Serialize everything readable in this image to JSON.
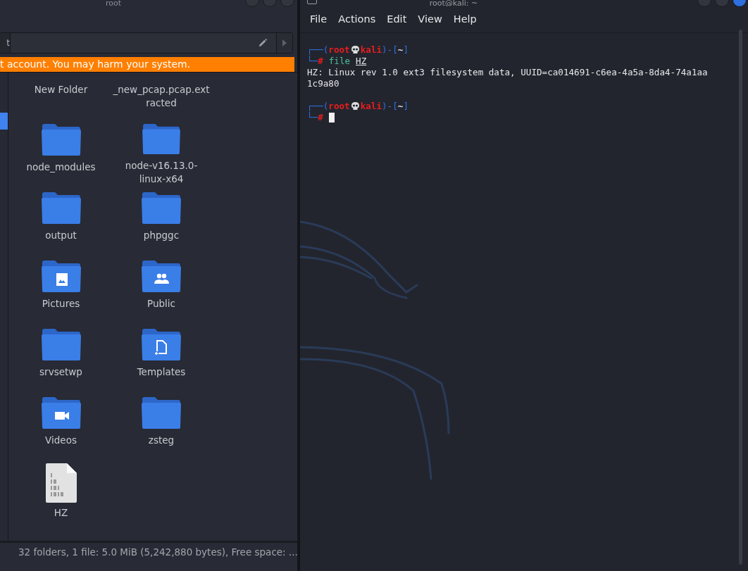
{
  "file_manager": {
    "title": "root",
    "path_bar": {
      "segment": "t"
    },
    "warning": "t account. You may harm your system.",
    "sidebar": {
      "items": [
        {
          "selected": true
        }
      ]
    },
    "items": [
      {
        "name": "New Folder",
        "kind": "hidden-icon"
      },
      {
        "name": "_new_pcap.pcap.extracted",
        "kind": "hidden-icon"
      },
      {
        "name": "node_modules",
        "kind": "folder"
      },
      {
        "name": "node-v16.13.0-linux-x64",
        "kind": "folder"
      },
      {
        "name": "output",
        "kind": "folder"
      },
      {
        "name": "phpggc",
        "kind": "folder"
      },
      {
        "name": "Pictures",
        "kind": "pictures-folder"
      },
      {
        "name": "Public",
        "kind": "public-folder"
      },
      {
        "name": "srvsetwp",
        "kind": "folder"
      },
      {
        "name": "Templates",
        "kind": "templates-folder"
      },
      {
        "name": "Videos",
        "kind": "videos-folder"
      },
      {
        "name": "zsteg",
        "kind": "folder"
      },
      {
        "name": "HZ",
        "kind": "binary-file"
      }
    ],
    "status_bar": "32 folders, 1 file: 5.0 MiB (5,242,880 bytes), Free space: ..."
  },
  "terminal": {
    "title": "root@kali: ~",
    "menu": [
      "File",
      "Actions",
      "Edit",
      "View",
      "Help"
    ],
    "lines": [
      {
        "kind": "prompt",
        "open": "┌──(",
        "user": "root",
        "host": "kali",
        "sep": ")-[",
        "dir": "~",
        "close": "]",
        "corner": "└─",
        "symbol": "#",
        "command": "file",
        "argument": "HZ"
      },
      {
        "kind": "output",
        "text": "HZ: Linux rev 1.0 ext3 filesystem data, UUID=ca014691-c6ea-4a5a-8da4-74a1aa"
      },
      {
        "kind": "output",
        "text": "1c9a80"
      },
      {
        "kind": "blank"
      },
      {
        "kind": "prompt",
        "open": "┌──(",
        "user": "root",
        "host": "kali",
        "sep": ")-[",
        "dir": "~",
        "close": "]",
        "corner": "└─",
        "symbol": "#",
        "cursor": true
      }
    ]
  }
}
